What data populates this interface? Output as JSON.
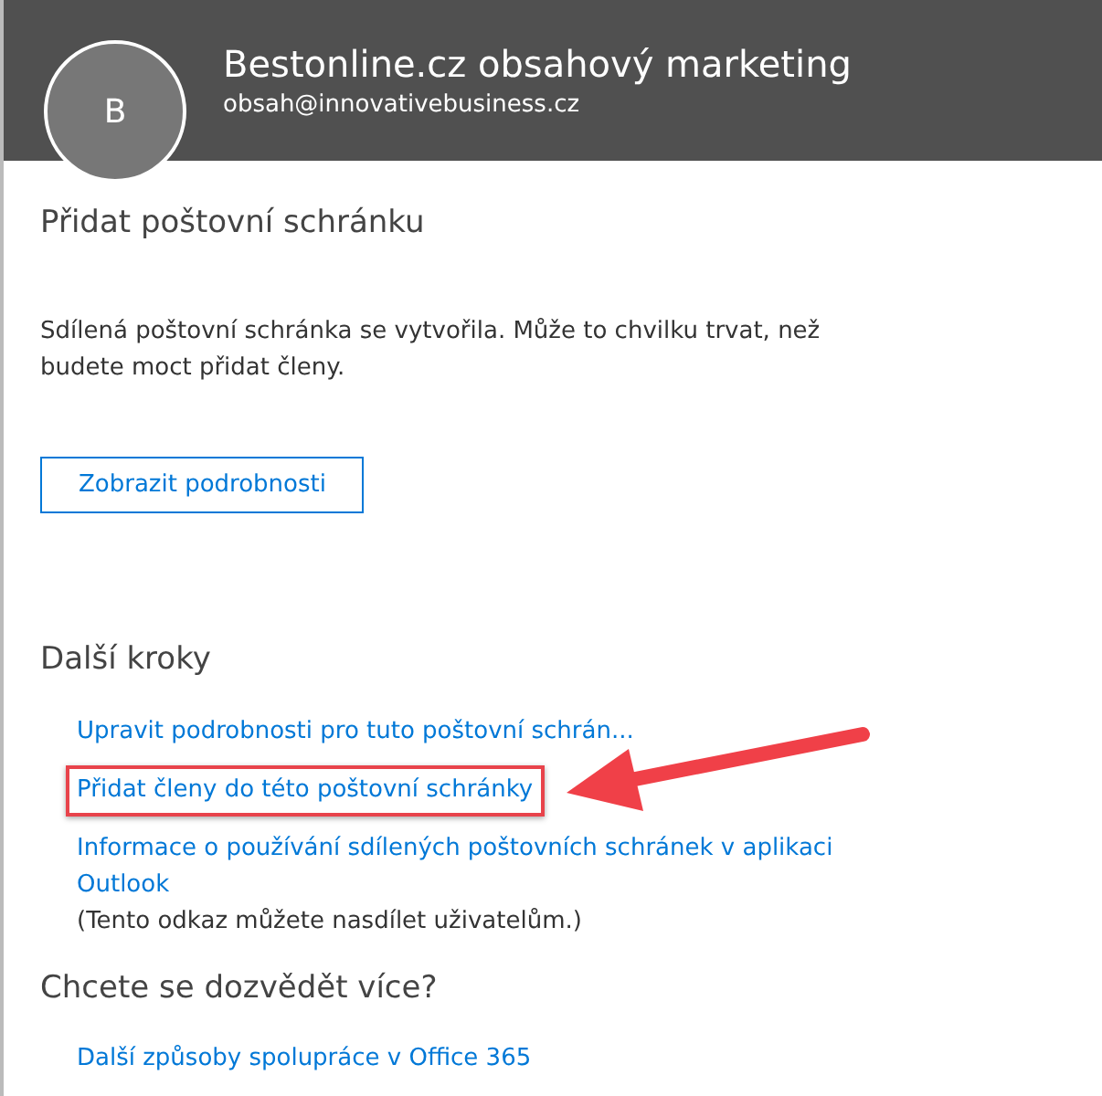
{
  "header": {
    "avatar_initial": "B",
    "name": "Bestonline.cz obsahový marketing",
    "email": "obsah@innovativebusiness.cz"
  },
  "title": "Přidat poštovní schránku",
  "message": "Sdílená poštovní schránka se vytvořila. Může to chvilku trvat, než budete moct přidat členy.",
  "details_button": "Zobrazit podrobnosti",
  "next_steps": {
    "heading": "Další kroky",
    "links": [
      {
        "label": "Upravit podrobnosti pro tuto poštovní schrán...",
        "highlighted": false
      },
      {
        "label": "Přidat členy do této poštovní schránky",
        "highlighted": true
      },
      {
        "label": "Informace o používání sdílených poštovních schránek v aplikaci Outlook",
        "highlighted": false,
        "note": "(Tento odkaz můžete nasdílet uživatelům.)"
      }
    ]
  },
  "learn_more": {
    "heading": "Chcete se dozvědět více?",
    "links": [
      "Další způsoby spolupráce v Office 365"
    ]
  }
}
